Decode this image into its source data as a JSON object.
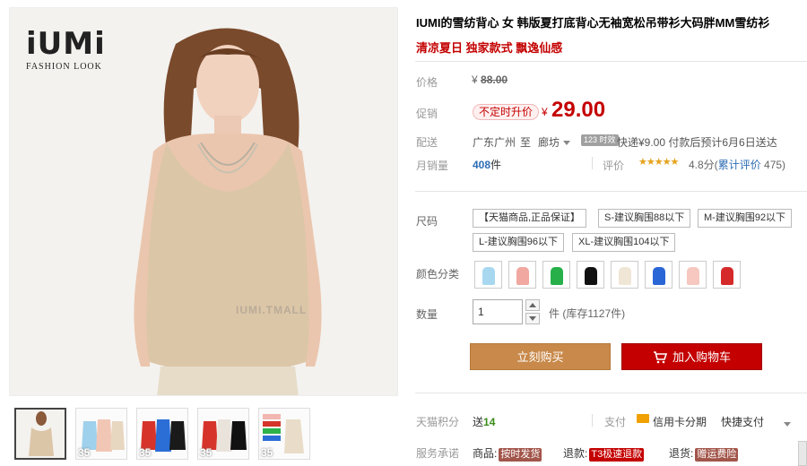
{
  "gallery": {
    "brand_name": "iUMi",
    "brand_sub": "FASHION LOOK",
    "watermark": "IUMI.TMALL",
    "thumbs": [
      {
        "badge": "",
        "colors": [
          "#dcc6a8",
          "#8a5a3a"
        ]
      },
      {
        "badge": "35",
        "colors": [
          "#9fd0ec",
          "#f2c6b5",
          "#e8d7c0"
        ]
      },
      {
        "badge": "35",
        "colors": [
          "#d6342a",
          "#2a6ed6",
          "#1a1a1a"
        ]
      },
      {
        "badge": "35",
        "colors": [
          "#d6342a",
          "#e9e3dc",
          "#111111"
        ]
      },
      {
        "badge": "35",
        "colors": [
          "#f2b7b0",
          "#d6342a",
          "#2cb24a",
          "#2a6ed6",
          "#e9dcc8"
        ]
      }
    ]
  },
  "product": {
    "title": "IUMI的雪纺背心 女 韩版夏打底背心无袖宽松吊带衫大码胖MM雪纺衫",
    "subtitle": "清凉夏日 独家款式 飘逸仙感"
  },
  "pricing": {
    "price_label": "价格",
    "currency": "¥",
    "original_price": "88.00",
    "promo_label": "促销",
    "promo_tag": "不定时升价",
    "current_price": "29.00"
  },
  "shipping": {
    "label": "配送",
    "from": "广东广州",
    "to_word": "至",
    "destination": "廊坊",
    "badge": "123 时效",
    "fee_text": "快递¥9.00 付款后预计6月6日送达"
  },
  "sales": {
    "label": "月销量",
    "count": "408",
    "unit": "件",
    "rating_label": "评价",
    "stars": "★★★★★",
    "rating_text": "4.8分(",
    "rating_link": "累计评价",
    "rating_count": " 475)"
  },
  "options": {
    "size_label": "尺码",
    "sizes": [
      "【天猫商品,正品保证】",
      "S-建议胸围88以下",
      "M-建议胸围92以下",
      "L-建议胸围96以下",
      "XL-建议胸围104以下"
    ],
    "color_label": "颜色分类",
    "colors": [
      "#a8d8f0",
      "#f0a8a0",
      "#27b04a",
      "#111111",
      "#f0e6d6",
      "#2a66d6",
      "#f6c8c0",
      "#d62a2a"
    ]
  },
  "quantity": {
    "label": "数量",
    "value": "1",
    "stock_text": "件 (库存1127件)"
  },
  "actions": {
    "buy_now": "立刻购买",
    "add_to_cart": "加入购物车"
  },
  "footer": {
    "points_label": "天猫积分",
    "points_prefix": "送",
    "points_value": "14",
    "pay_label": "支付",
    "card_text": "信用卡分期",
    "fast_text": "快捷支付",
    "service_label": "服务承诺",
    "svc1_prefix": "商品:",
    "svc1_badge": "按时发货",
    "svc2_prefix": "退款:",
    "svc2_badge": "T3极速退款",
    "svc3_prefix": "退货:",
    "svc3_badge": "赠运费险",
    "accent_red": "#c40000",
    "accent_brown": "#c8894a"
  }
}
